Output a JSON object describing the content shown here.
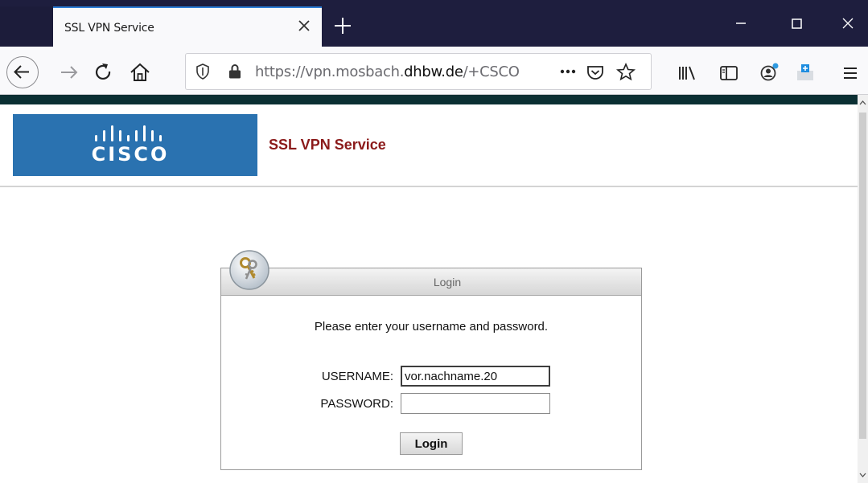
{
  "browser": {
    "tab": {
      "title": "SSL VPN Service"
    },
    "url": {
      "prefix": "https://vpn.mosbach.",
      "domain": "dhbw.de",
      "suffix": "/+CSCO"
    },
    "icons": {
      "back": "back-arrow-icon",
      "forward": "forward-arrow-icon",
      "reload": "reload-icon",
      "home": "home-icon",
      "tracking": "shield-icon",
      "lock": "lock-icon",
      "more": "more-dots-icon",
      "pocket": "pocket-icon",
      "bookmark": "star-icon",
      "library": "library-icon",
      "sidebar": "sidebar-icon",
      "account": "account-icon",
      "extension": "extension-icon",
      "menu": "hamburger-menu-icon"
    }
  },
  "page": {
    "logo": {
      "word": "CISCO",
      "color": "#2a72b0"
    },
    "header_title": "SSL VPN Service",
    "header_title_color": "#8b1a1a",
    "login": {
      "box_title": "Login",
      "prompt": "Please enter your username and password.",
      "username_label": "USERNAME:",
      "username_value": "vor.nachname.20",
      "password_label": "PASSWORD:",
      "password_value": "",
      "button_label": "Login"
    }
  }
}
